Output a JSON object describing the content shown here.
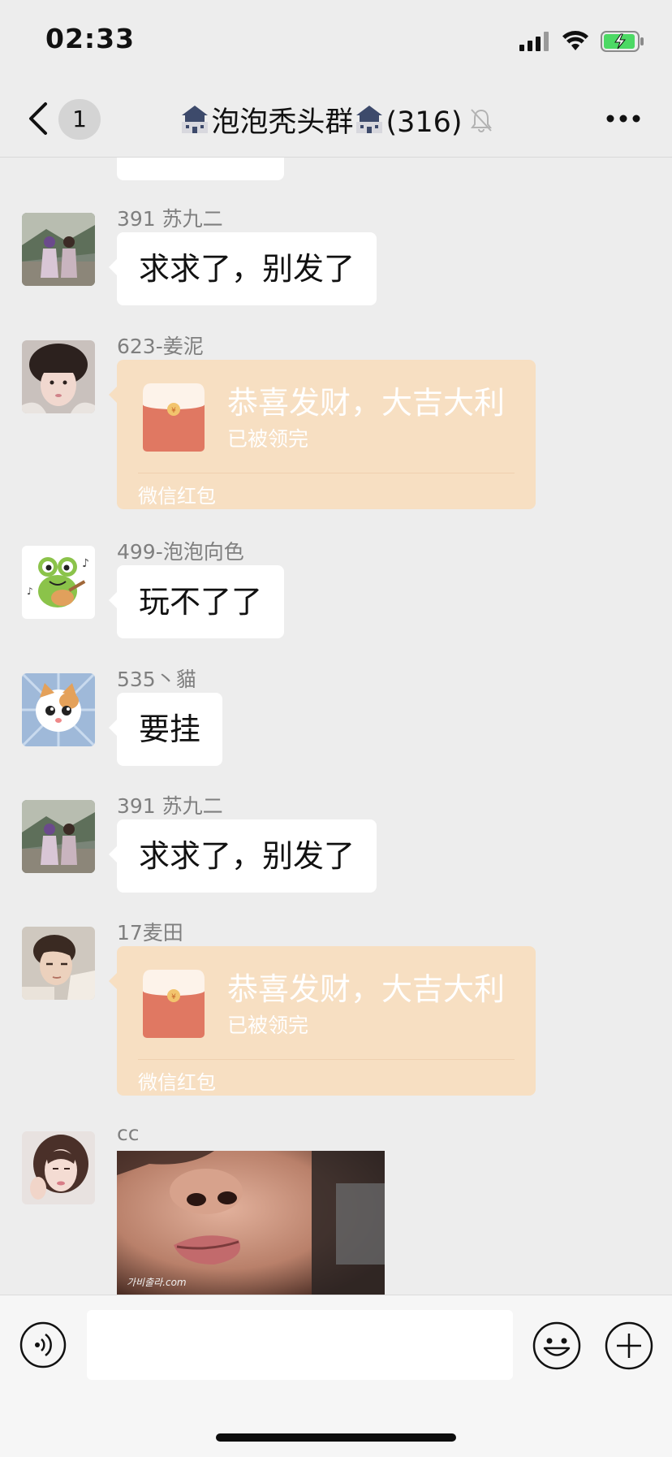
{
  "status_bar": {
    "time": "02:33"
  },
  "nav": {
    "back_label": "1",
    "title": "泡泡秃头群",
    "member_count": "(316)"
  },
  "messages": [
    {
      "type": "text",
      "sender": "391 苏九二",
      "text": "求求了，别发了",
      "avatar": "couple-photo"
    },
    {
      "type": "red_packet",
      "sender": "623-姜泥",
      "title": "恭喜发财，大吉大利",
      "status": "已被领完",
      "footer": "微信红包",
      "avatar": "girl-photo"
    },
    {
      "type": "text",
      "sender": "499-泡泡向色",
      "text": "玩不了了",
      "avatar": "frog-sticker"
    },
    {
      "type": "text",
      "sender": "535丶貓",
      "text": "要挂",
      "avatar": "cat-sticker"
    },
    {
      "type": "text",
      "sender": "391 苏九二",
      "text": "求求了，别发了",
      "avatar": "couple-photo"
    },
    {
      "type": "red_packet",
      "sender": "17麦田",
      "title": "恭喜发财，大吉大利",
      "status": "已被领完",
      "footer": "微信红包",
      "avatar": "boy-photo"
    },
    {
      "type": "image",
      "sender": "cc",
      "watermark": "가비출라.com",
      "avatar": "woman-photo"
    }
  ],
  "input_bar": {
    "placeholder": ""
  },
  "colors": {
    "background": "#ededed",
    "bubble": "#ffffff",
    "red_packet": "#f7dfc2",
    "red_envelope": "#e07862"
  }
}
